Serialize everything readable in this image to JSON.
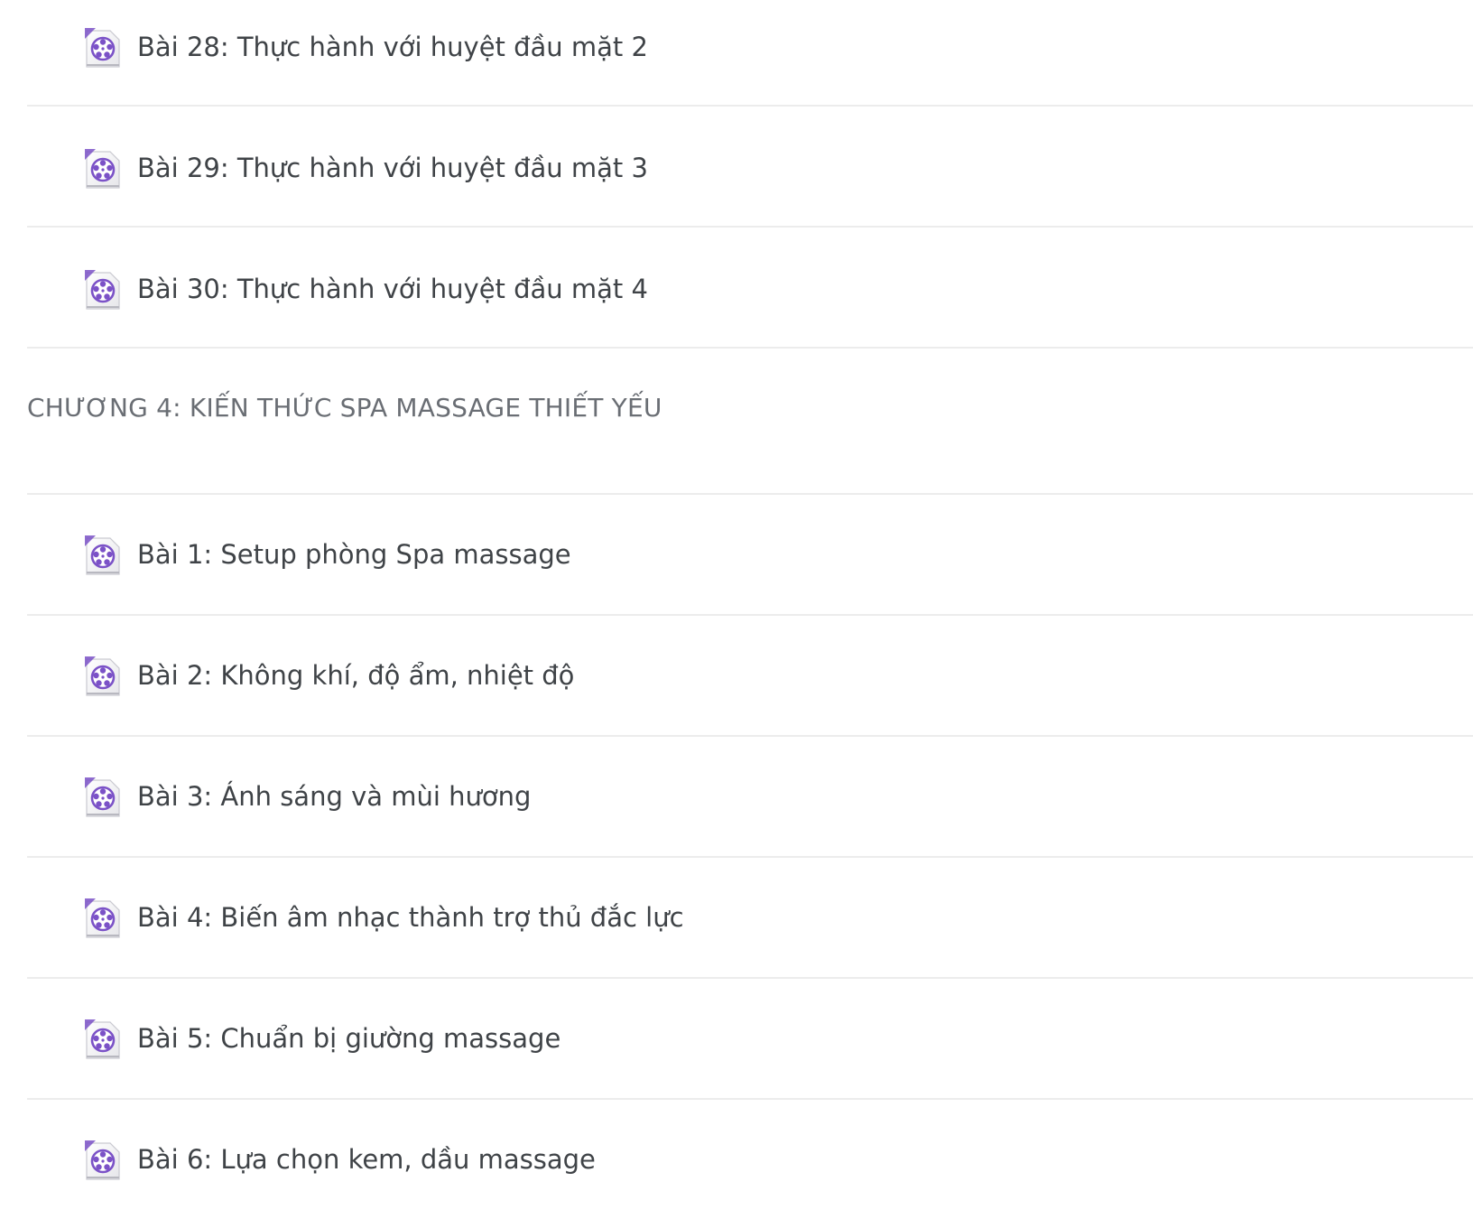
{
  "colors": {
    "text": "#3f4347",
    "chapter_text": "#6a6e74",
    "divider": "#ececec",
    "icon_accent": "#7b52c7"
  },
  "icon_name": "video-file-icon",
  "lessons_top": [
    {
      "label": "Bài 28: Thực hành với huyệt đầu mặt 2"
    },
    {
      "label": "Bài 29: Thực hành với huyệt đầu mặt 3"
    },
    {
      "label": "Bài 30: Thực hành với huyệt đầu mặt 4"
    }
  ],
  "chapter": {
    "title": "CHƯƠNG 4: KIẾN THỨC SPA MASSAGE THIẾT YẾU"
  },
  "lessons_chapter4": [
    {
      "label": "Bài 1: Setup phòng Spa massage"
    },
    {
      "label": "Bài 2: Không khí, độ ẩm, nhiệt độ"
    },
    {
      "label": "Bài 3: Ánh sáng và mùi hương"
    },
    {
      "label": "Bài 4: Biến âm nhạc thành trợ thủ đắc lực"
    },
    {
      "label": "Bài 5: Chuẩn bị giường massage"
    },
    {
      "label": "Bài 6: Lựa chọn kem, dầu massage"
    }
  ]
}
